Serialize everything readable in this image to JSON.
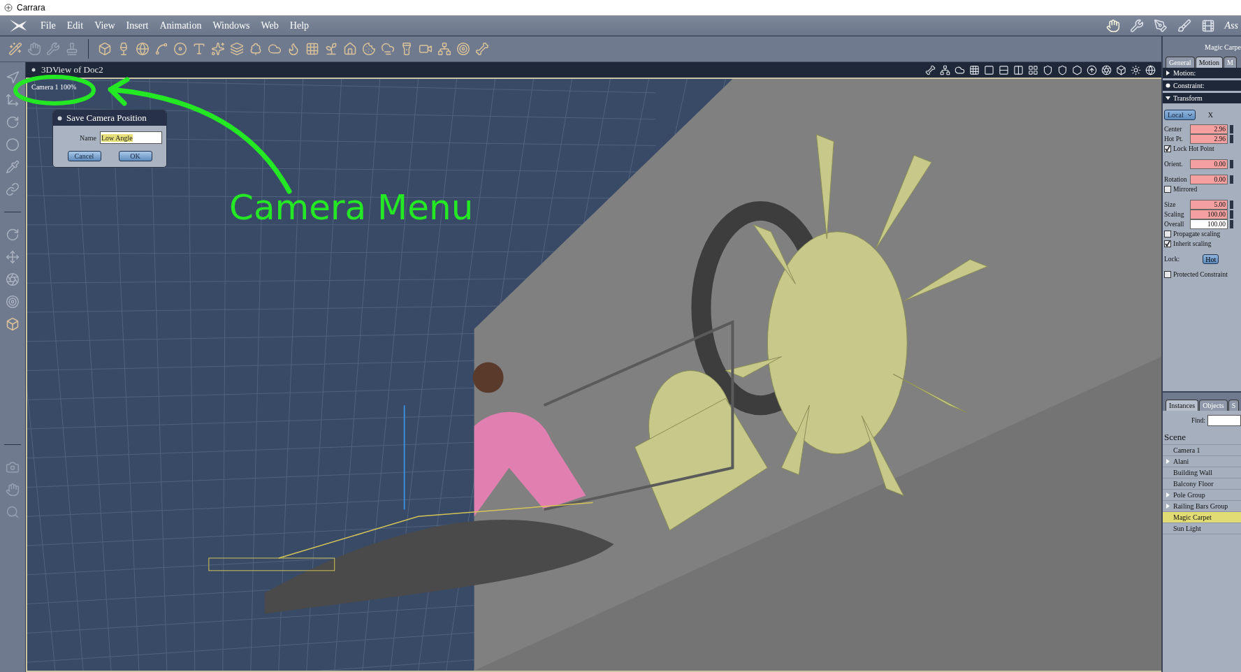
{
  "window": {
    "title": "Carrara"
  },
  "menu": [
    "File",
    "Edit",
    "View",
    "Insert",
    "Animation",
    "Windows",
    "Web",
    "Help"
  ],
  "room_label": "Ass",
  "viewport": {
    "title": "3DView of Doc2",
    "camera_label": "Camera 1 100%"
  },
  "dialog": {
    "title": "Save Camera Position",
    "name_label": "Name",
    "name_value": "Low Angle",
    "buttons": [
      "Cancel",
      "OK"
    ]
  },
  "annotation": {
    "text": "Camera Menu"
  },
  "properties": {
    "object_name": "Magic Carpe",
    "tabs": [
      {
        "label": "General",
        "selected": false
      },
      {
        "label": "Motion",
        "selected": true
      },
      {
        "label": "M",
        "selected": false
      }
    ],
    "sections": [
      {
        "label": "Motion:",
        "kind": "disclosure",
        "expanded": false
      },
      {
        "label": "Constraint:",
        "kind": "bullet"
      },
      {
        "label": "Transform",
        "kind": "disclosure",
        "expanded": true
      }
    ],
    "space": "Local",
    "axis": "X",
    "groups": [
      [
        {
          "kind": "field",
          "label": "Center",
          "value": "2.96",
          "highlighted": true
        },
        {
          "kind": "field",
          "label": "Hot Pt.",
          "value": "2.96",
          "highlighted": true
        },
        {
          "kind": "checkbox",
          "label": "Lock Hot Point",
          "checked": true
        }
      ],
      [
        {
          "kind": "field",
          "label": "Orient.",
          "value": "0.00",
          "highlighted": true
        }
      ],
      [
        {
          "kind": "field",
          "label": "Rotation",
          "value": "0.00",
          "highlighted": true
        },
        {
          "kind": "checkbox",
          "label": "Mirrored",
          "checked": false
        }
      ],
      [
        {
          "kind": "field",
          "label": "Size",
          "value": "5.00",
          "highlighted": true
        },
        {
          "kind": "field",
          "label": "Scaling",
          "value": "100.00",
          "highlighted": true
        },
        {
          "kind": "field",
          "label": "Overall",
          "value": "100.00",
          "highlighted": false
        },
        {
          "kind": "checkbox",
          "label": "Propagate scaling",
          "checked": false
        },
        {
          "kind": "checkbox",
          "label": "Inherit scaling",
          "checked": true
        }
      ],
      [
        {
          "kind": "lock",
          "label": "Lock:",
          "value": "Hot"
        }
      ],
      [
        {
          "kind": "checkbox",
          "label": "Protected Constraint",
          "checked": false
        }
      ]
    ]
  },
  "browser": {
    "tabs": [
      {
        "label": "Instances",
        "selected": true
      },
      {
        "label": "Objects",
        "selected": false
      },
      {
        "label": "S",
        "selected": false
      }
    ],
    "find_label": "Find:",
    "heading": "Scene",
    "items": [
      {
        "label": "Camera 1",
        "selected": false
      },
      {
        "label": "Alani",
        "selected": false,
        "expanded": false
      },
      {
        "label": "Building Wall",
        "selected": false
      },
      {
        "label": "Balcony Floor",
        "selected": false
      },
      {
        "label": "Pole Group",
        "selected": false,
        "expanded": false
      },
      {
        "label": "Railing Bars Group",
        "selected": false,
        "expanded": false
      },
      {
        "label": "Magic Carpet",
        "selected": true
      },
      {
        "label": "Sun Light",
        "selected": false
      }
    ]
  }
}
